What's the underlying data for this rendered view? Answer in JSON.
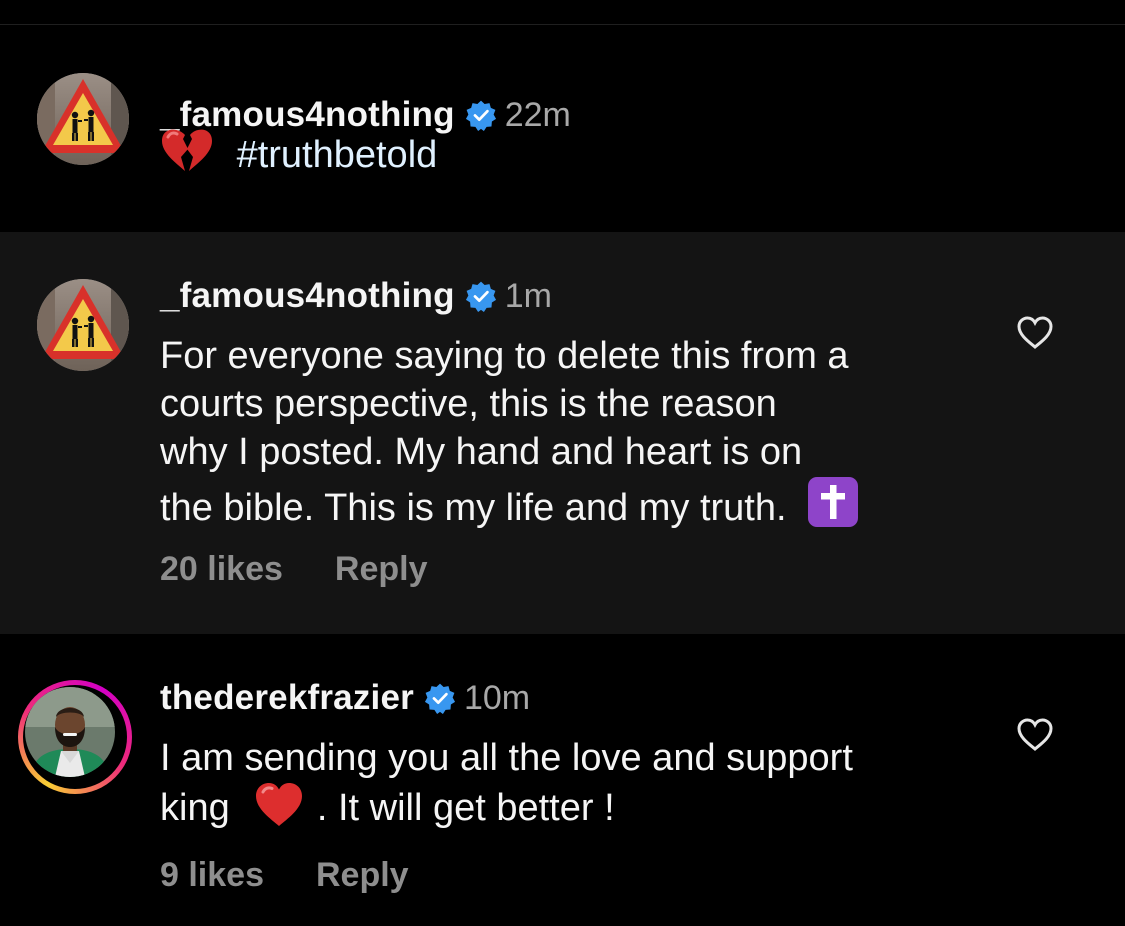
{
  "caption": {
    "username": "_famous4nothing",
    "time": "22m",
    "emoji": "broken-heart-emoji",
    "text": "#truthbetold"
  },
  "comments": [
    {
      "username": "_famous4nothing",
      "time": "1m",
      "lines": [
        "For everyone saying to delete this from a",
        "courts perspective, this is the reason",
        "why I posted. My hand and heart is on",
        "the bible. This is my life and my truth."
      ],
      "trailing_emoji": "latin-cross-emoji",
      "likes": "20 likes",
      "reply": "Reply",
      "highlighted": true
    },
    {
      "username": "thederekfrazier",
      "time": "10m",
      "line1": "I am sending you all the love and support",
      "line2_before": "king",
      "line2_emoji": "red-heart-emoji",
      "line2_after": ". It will get better !",
      "likes": "9 likes",
      "reply": "Reply",
      "story_ring": true
    }
  ],
  "icons": {
    "verified": "verified-badge-icon",
    "like": "heart-outline-icon"
  },
  "colors": {
    "background": "#000000",
    "highlight_background": "#141414",
    "primary_text": "#f5f5f5",
    "secondary_text": "#8e8e8e",
    "verified_blue": "#3897f0",
    "hashtag": "#e0f1ff"
  }
}
